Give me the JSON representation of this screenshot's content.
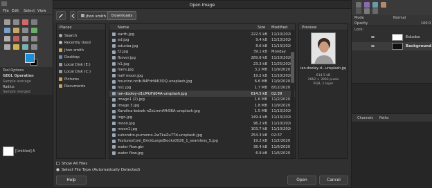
{
  "dialog": {
    "title": "Open Image",
    "path_user": "jhon smith",
    "path_folder": "Downloads",
    "places_header": "Places",
    "places": [
      {
        "label": "Search",
        "icon": "search-icon"
      },
      {
        "label": "Recently Used",
        "icon": "clock-icon"
      },
      {
        "label": "jhon smith",
        "icon": "home-folder-icon"
      },
      {
        "label": "Desktop",
        "icon": "desktop-icon"
      },
      {
        "label": "Local Disk (E:)",
        "icon": "drive-icon"
      },
      {
        "label": "Local Disk (C:)",
        "icon": "drive-icon"
      },
      {
        "label": "Pictures",
        "icon": "folder-icon"
      },
      {
        "label": "Documents",
        "icon": "folder-icon"
      }
    ],
    "columns": {
      "name": "Name",
      "size": "Size",
      "modified": "Modified"
    },
    "files": [
      {
        "name": "earth.jpg",
        "size": "222.5 kB",
        "modified": "11/10/2020"
      },
      {
        "name": "ed.jpg",
        "size": "9.4 kB",
        "modified": "11/13/2020"
      },
      {
        "name": "educba.jpg",
        "size": "8.6 kB",
        "modified": "11/13/2020"
      },
      {
        "name": "f2.jpg",
        "size": "39.1 kB",
        "modified": "Monday"
      },
      {
        "name": "fbsver.jpg",
        "size": "289.8 kB",
        "modified": "11/10/2020"
      },
      {
        "name": "h1.jpg",
        "size": "23.3 kB",
        "modified": "11/25/2020"
      },
      {
        "name": "hairs.jpg",
        "size": "3.2 MB",
        "modified": "11/9/2020"
      },
      {
        "name": "half moon.jpg",
        "size": "19.2 kB",
        "modified": "11/10/2020"
      },
      {
        "name": "houcine-ncib-B4FdrNiK3OQ-unsplash.jpg",
        "size": "6.6 MB",
        "modified": "11/9/2020"
      },
      {
        "name": "hs1.jpg",
        "size": "1.7 MB",
        "modified": "8/12/2020"
      },
      {
        "name": "ian-dooley-d1UPkiFd04A-unsplash.jpg",
        "size": "614.5 kB",
        "modified": "02:39"
      },
      {
        "name": "image1 (2).jpg",
        "size": "1.6 MB",
        "modified": "11/2/2020"
      },
      {
        "name": "image 3.jpg",
        "size": "1.8 MB",
        "modified": "11/9/2020"
      },
      {
        "name": "Karolina-bobek-nZxLmmMh5BA-unsplash.jpg",
        "size": "1.5 MB",
        "modified": "11/13/2020"
      },
      {
        "name": "logo.jpg",
        "size": "149.4 kB",
        "modified": "11/13/2020"
      },
      {
        "name": "moon.jpg",
        "size": "96.2 kB",
        "modified": "11/10/2020"
      },
      {
        "name": "moon1.jpg",
        "size": "103.7 kB",
        "modified": "11/10/2020"
      },
      {
        "name": "suhendro-purnomo-2wTkaZu7Td-unsplash.jpg",
        "size": "254.3 kB",
        "modified": "02:37"
      },
      {
        "name": "TexturesCom_BrickLargeBlocks0026_1_seamless_S.jpg",
        "size": "19.2 kB",
        "modified": "11/2/2020"
      },
      {
        "name": "water flow.gbr",
        "size": "38.4 kB",
        "modified": "11/6/2020"
      },
      {
        "name": "water flow.jpg",
        "size": "6.9 kB",
        "modified": "11/6/2020"
      }
    ],
    "selected_index": 10,
    "preview": {
      "header": "Preview",
      "filename": "ian-dooley-d...unsplash.jpg",
      "size": "614.5 kB",
      "dims": "2662 × 3993 pixels",
      "mode": "RGB, 1 layer"
    },
    "show_all_files": "Show All Files",
    "file_type": "Select File Type (Automatically Detected)",
    "help": "Help",
    "open": "Open",
    "cancel": "Cancel"
  },
  "gimp_left": {
    "menu": [
      "File",
      "Edit",
      "Select",
      "View"
    ],
    "tool_options": "Tool Options",
    "option1": "GEGL Operation",
    "option2": "Sample average",
    "option3": "Radius",
    "option4": "Sample merged",
    "image_label": "[Untitled]-5"
  },
  "gimp_right": {
    "mode_label": "Mode",
    "mode_value": "Normal",
    "opacity_label": "Opacity",
    "lock_label": "Lock:",
    "layers": [
      {
        "name": "Educba"
      },
      {
        "name": "Background"
      }
    ],
    "channels_tab": "Channels",
    "paths_tab": "Paths",
    "opacity_value": "100.0"
  },
  "colors": {
    "fg": "#1a8fd8",
    "bg": "#000000",
    "selected_row": "#3d3d3d"
  }
}
